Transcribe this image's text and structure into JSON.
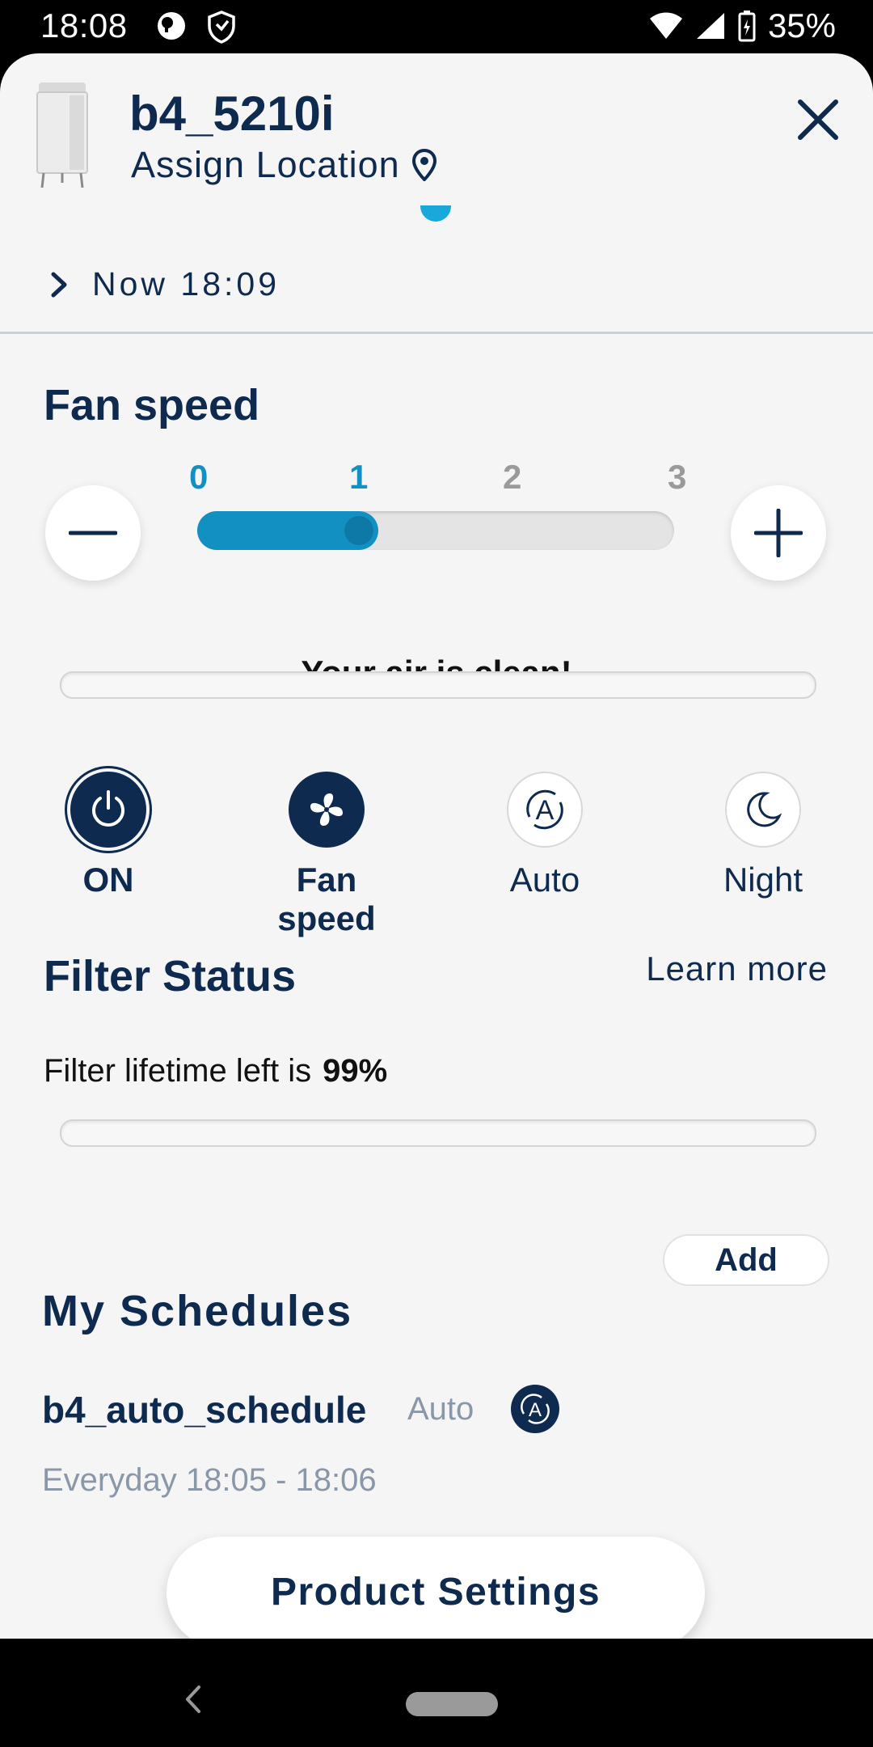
{
  "status_bar": {
    "time": "18:08",
    "battery": "35%"
  },
  "header": {
    "device_name": "b4_5210i",
    "location_label": "Assign Location"
  },
  "timeline": {
    "now_label": "Now 18:09"
  },
  "fan_speed": {
    "title": "Fan speed",
    "ticks": [
      "0",
      "1",
      "2",
      "3"
    ],
    "current_level": 1,
    "max_level": 3,
    "air_status": "Your air is clean!"
  },
  "modes": [
    {
      "label": "ON",
      "icon": "power-icon",
      "active": true
    },
    {
      "label": "Fan speed",
      "icon": "fan-icon",
      "active": true
    },
    {
      "label": "Auto",
      "icon": "auto-icon",
      "active": false
    },
    {
      "label": "Night",
      "icon": "moon-icon",
      "active": false
    }
  ],
  "filter": {
    "title": "Filter Status",
    "learn_more": "Learn more",
    "lifetime_label": "Filter lifetime left is",
    "lifetime_value": "99%"
  },
  "schedules": {
    "title": "My Schedules",
    "add_label": "Add",
    "items": [
      {
        "name": "b4_auto_schedule",
        "mode": "Auto",
        "time": "Everyday 18:05 - 18:06"
      }
    ]
  },
  "product_settings_label": "Product Settings",
  "colors": {
    "navy": "#0e2a4f",
    "accent_blue": "#1390c2",
    "background": "#f5f5f5"
  }
}
